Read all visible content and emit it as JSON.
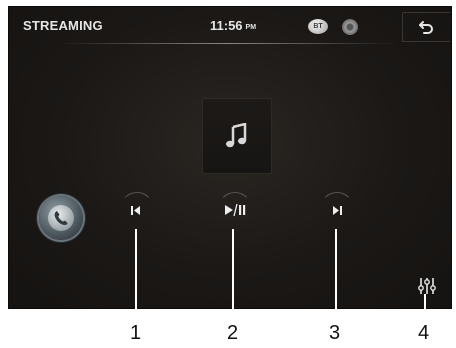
{
  "header": {
    "title": "STREAMING",
    "time": "11:56",
    "ampm": "PM",
    "bt_badge": "BT"
  },
  "icons": {
    "back": "back-arrow-icon",
    "bluetooth": "bluetooth-badge-icon",
    "disc": "disc-icon",
    "album_art": "music-note-icon",
    "phone": "phone-icon",
    "previous": "skip-previous-icon",
    "play_pause": "play-pause-icon",
    "next": "skip-next-icon",
    "equalizer": "equalizer-icon"
  },
  "callouts": [
    "1",
    "2",
    "3",
    "4"
  ],
  "colors": {
    "screen_bg": "#1b1816",
    "text": "#e6e6e6",
    "callout_line": "#ffffff"
  }
}
